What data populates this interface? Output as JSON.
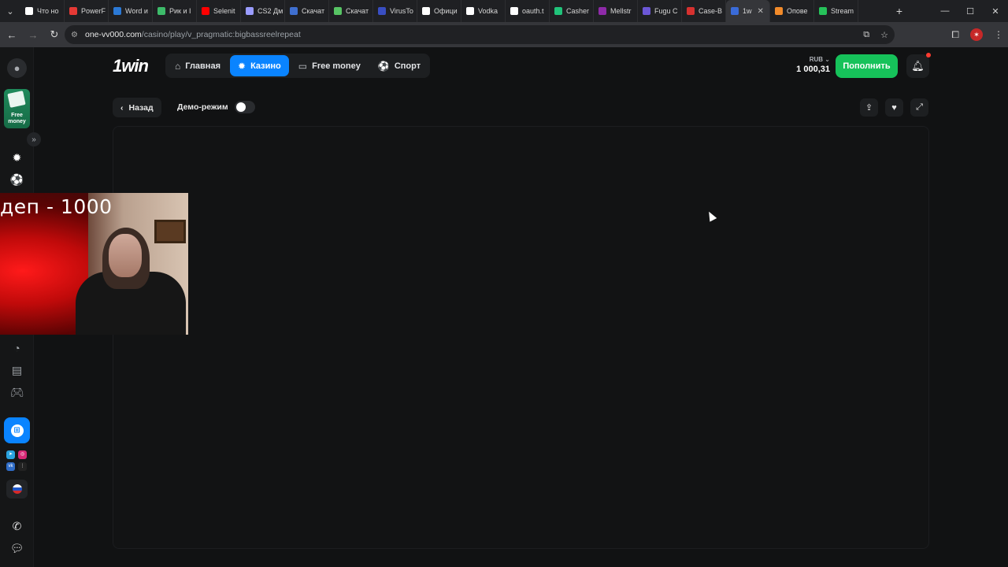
{
  "browser": {
    "tabs": [
      {
        "label": "Что но",
        "color": "#ffffff"
      },
      {
        "label": "PowerF",
        "color": "#e53935"
      },
      {
        "label": "Word и",
        "color": "#2b79d6"
      },
      {
        "label": "Рик и I",
        "color": "#3dbb6a"
      },
      {
        "label": "Selenit",
        "color": "#ff0000"
      },
      {
        "label": "CS2 Дм",
        "color": "#9a9cff"
      },
      {
        "label": "Скачат",
        "color": "#3f6fd0"
      },
      {
        "label": "Скачат",
        "color": "#57c464"
      },
      {
        "label": "VirusTo",
        "color": "#394ec2"
      },
      {
        "label": "Офици",
        "color": "#ffffff"
      },
      {
        "label": "Vodka",
        "color": "#ffffff"
      },
      {
        "label": "oauth.t",
        "color": "#ffffff"
      },
      {
        "label": "Casher",
        "color": "#20c37a"
      },
      {
        "label": "Mellstr",
        "color": "#8e2aa8"
      },
      {
        "label": "Fugu C",
        "color": "#6b57d6"
      },
      {
        "label": "Case-B",
        "color": "#d6312f"
      },
      {
        "label": "1w",
        "color": "#3a6bd8",
        "active": true
      },
      {
        "label": "Опове",
        "color": "#f28b2a"
      },
      {
        "label": "Stream",
        "color": "#26c25a"
      }
    ],
    "url_domain": "one-vv000.com",
    "url_path": "/casino/play/v_pragmatic:bigbassreelrepeat"
  },
  "header": {
    "logo": "1win",
    "nav": [
      {
        "label": "Главная",
        "icon": "home-icon"
      },
      {
        "label": "Казино",
        "icon": "casino-icon",
        "active": true
      },
      {
        "label": "Free money",
        "icon": "money-icon"
      },
      {
        "label": "Спорт",
        "icon": "sport-icon"
      }
    ],
    "currency": "RUB",
    "balance": "1 000,31",
    "deposit_label": "Пополнить"
  },
  "rail": {
    "free_money_label": "Free money"
  },
  "toolbar": {
    "back_label": "Назад",
    "demo_label": "Демо-режим"
  },
  "webcam": {
    "caption": "деп - 1000"
  },
  "colors": {
    "accent": "#0a84ff",
    "deposit": "#16c25a",
    "background": "#111213"
  }
}
